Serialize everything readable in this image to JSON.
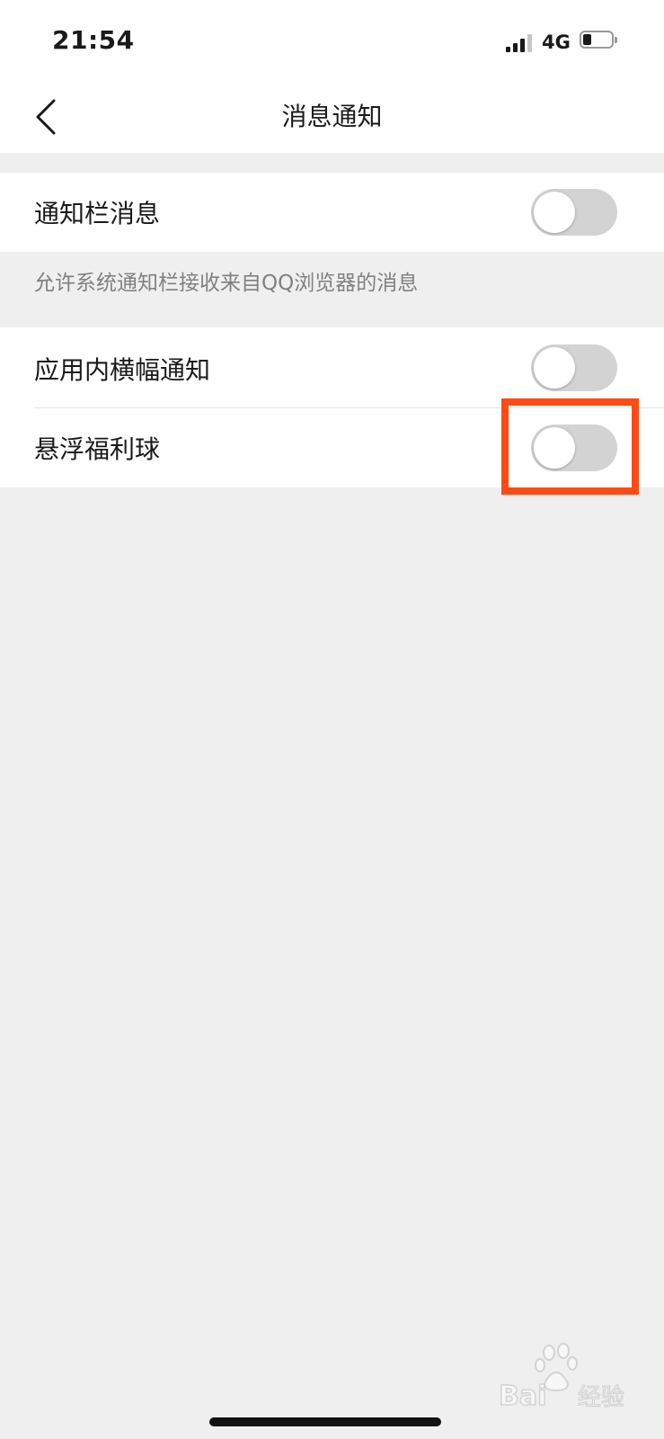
{
  "status_bar": {
    "time": "21:54",
    "network": "4G",
    "signal_icon": "cellular-signal-icon",
    "battery_icon": "battery-low-icon"
  },
  "nav": {
    "back_icon": "chevron-left-icon",
    "title": "消息通知"
  },
  "settings": {
    "notification_bar": {
      "label": "通知栏消息",
      "enabled": false
    },
    "notification_bar_hint": "允许系统通知栏接收来自QQ浏览器的消息",
    "in_app_banner": {
      "label": "应用内横幅通知",
      "enabled": false
    },
    "floating_bonus_ball": {
      "label": "悬浮福利球",
      "enabled": false
    }
  },
  "annotation": {
    "highlight_color": "#ff4a14"
  },
  "colors": {
    "background": "#efefef",
    "toggle_off": "#d3d3d3",
    "hint_text": "#808080"
  }
}
